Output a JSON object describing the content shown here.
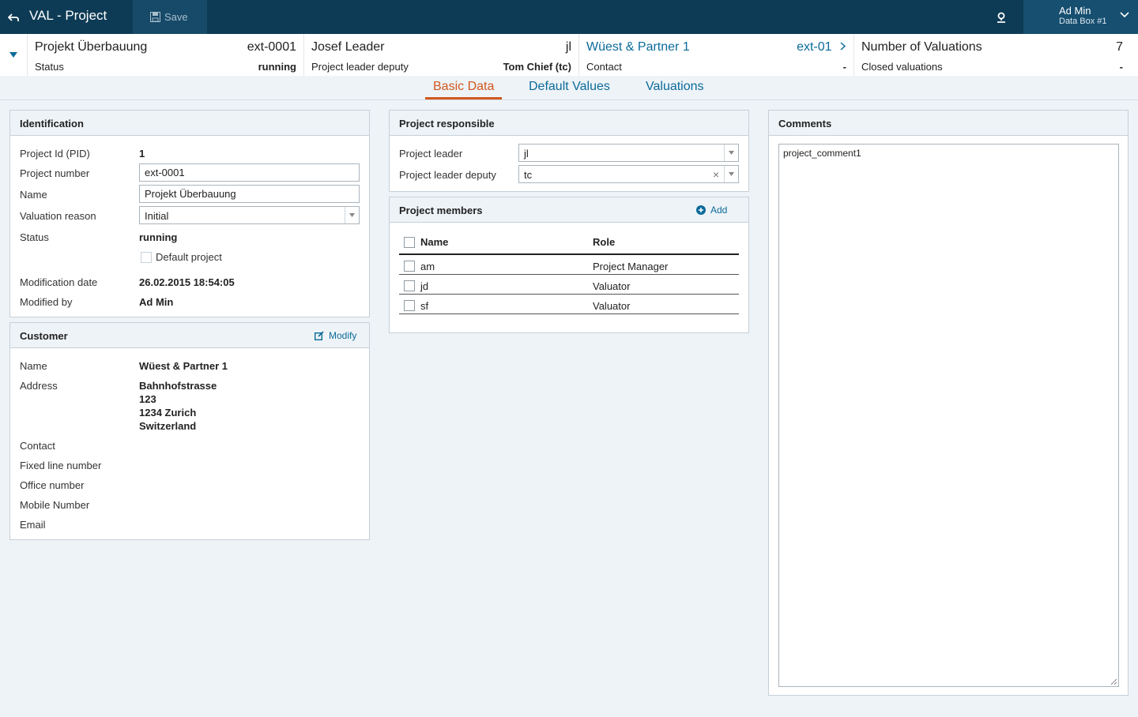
{
  "app": {
    "back_icon": "back-arrow-icon",
    "title": "VAL - Project",
    "save_label": "Save",
    "pin_icon": "location-pin-icon"
  },
  "user": {
    "name": "Ad Min",
    "box": "Data Box #1"
  },
  "summary": {
    "project": {
      "name": "Projekt Überbauung",
      "number": "ext-0001",
      "sub_label": "Status",
      "sub_value": "running"
    },
    "leader": {
      "name": "Josef Leader",
      "code": "jl",
      "sub_label": "Project leader deputy",
      "sub_value": "Tom Chief (tc)"
    },
    "customer": {
      "name": "Wüest & Partner 1",
      "code": "ext-01",
      "sub_label": "Contact",
      "sub_value": "-"
    },
    "valuations": {
      "label": "Number of Valuations",
      "count": "7",
      "sub_label": "Closed valuations",
      "sub_value": "-"
    }
  },
  "tabs": [
    {
      "label": "Basic Data",
      "active": true
    },
    {
      "label": "Default Values",
      "active": false
    },
    {
      "label": "Valuations",
      "active": false
    }
  ],
  "identification": {
    "title": "Identification",
    "pid_label": "Project Id (PID)",
    "pid_value": "1",
    "number_label": "Project number",
    "number_value": "ext-0001",
    "name_label": "Name",
    "name_value": "Projekt Überbauung",
    "reason_label": "Valuation reason",
    "reason_value": "Initial",
    "status_label": "Status",
    "status_value": "running",
    "default_label": "Default project",
    "default_checked": false,
    "mod_date_label": "Modification date",
    "mod_date_value": "26.02.2015 18:54:05",
    "mod_by_label": "Modified by",
    "mod_by_value": "Ad Min"
  },
  "customer": {
    "title": "Customer",
    "modify_label": "Modify",
    "name_label": "Name",
    "name_value": "Wüest & Partner 1",
    "address_label": "Address",
    "address_lines": [
      "Bahnhofstrasse",
      "123",
      "1234 Zurich",
      "Switzerland"
    ],
    "contact_label": "Contact",
    "fixed_label": "Fixed line number",
    "office_label": "Office number",
    "mobile_label": "Mobile Number",
    "email_label": "Email"
  },
  "responsible": {
    "title": "Project responsible",
    "leader_label": "Project leader",
    "leader_value": "jl",
    "deputy_label": "Project leader deputy",
    "deputy_value": "tc"
  },
  "members": {
    "title": "Project members",
    "add_label": "Add",
    "col_name": "Name",
    "col_role": "Role",
    "rows": [
      {
        "name": "am",
        "role": "Project Manager"
      },
      {
        "name": "jd",
        "role": "Valuator"
      },
      {
        "name": "sf",
        "role": "Valuator"
      }
    ]
  },
  "comments": {
    "title": "Comments",
    "text": "project_comment1"
  }
}
